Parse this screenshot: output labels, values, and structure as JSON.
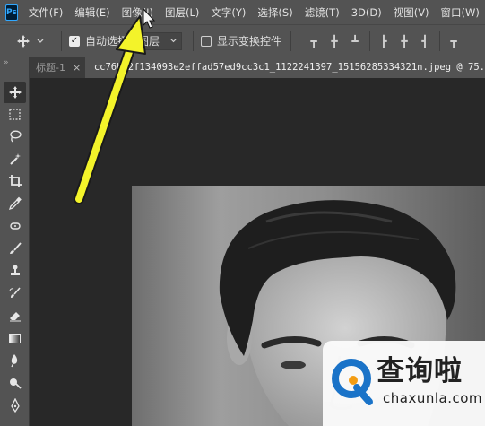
{
  "app": {
    "logo": "Ps"
  },
  "menu": [
    "文件(F)",
    "编辑(E)",
    "图像(I)",
    "图层(L)",
    "文字(Y)",
    "选择(S)",
    "滤镜(T)",
    "3D(D)",
    "视图(V)",
    "窗口(W)"
  ],
  "options": {
    "auto_select_label": "自动选择",
    "auto_select_checked": true,
    "layer_select_value": "图层",
    "show_transform_label": "显示变换控件",
    "show_transform_checked": false
  },
  "tabs": [
    {
      "label": "标题-1",
      "close": "×",
      "active": false
    },
    {
      "label": "cc76b92f134093e2effad57ed9cc3c1_1122241397_15156285334321n.jpeg @ 75.",
      "active": true
    }
  ],
  "toolbar_header": "»",
  "tools": [
    "move-icon",
    "marquee-icon",
    "lasso-icon",
    "magic-wand-icon",
    "crop-icon",
    "eyedropper-icon",
    "healing-brush-icon",
    "brush-icon",
    "clone-stamp-icon",
    "history-brush-icon",
    "eraser-icon",
    "gradient-icon",
    "blur-icon",
    "dodge-icon",
    "pen-icon"
  ],
  "watermark": {
    "text": "查询啦",
    "url": "chaxunla.com"
  },
  "colors": {
    "arrow": "#f3f32a",
    "watermark_blue": "#1a73c8",
    "watermark_orange": "#f39c12"
  }
}
